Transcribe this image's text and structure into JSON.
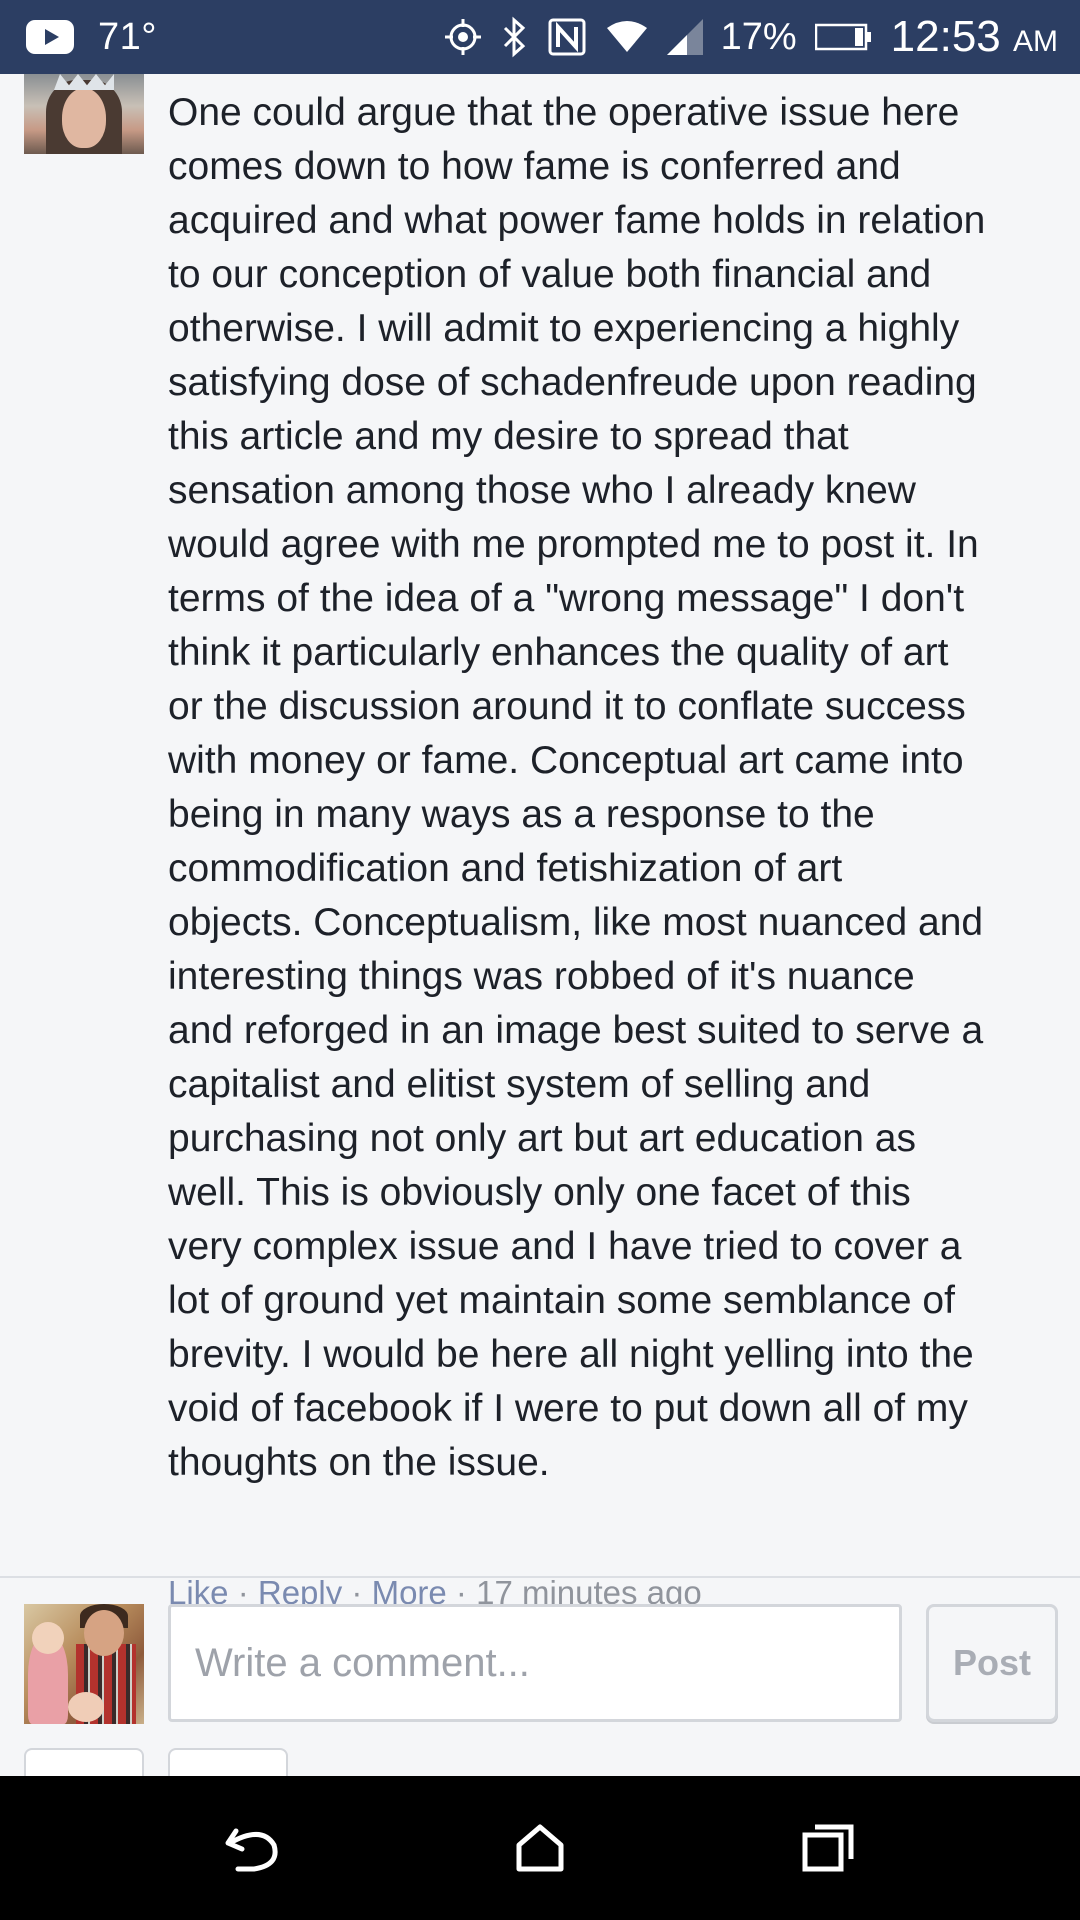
{
  "status_bar": {
    "temperature": "71°",
    "battery_percent": "17%",
    "time": "12:53",
    "ampm": "AM",
    "icons": [
      "youtube-icon",
      "location-icon",
      "bluetooth-icon",
      "nfc-icon",
      "wifi-icon",
      "signal-icon",
      "battery-icon"
    ]
  },
  "comment": {
    "lines": [
      "One could argue that the operative issue here",
      "comes down to how fame is conferred and",
      "acquired and what power fame holds in relation",
      "to our conception of value both financial and",
      "otherwise. I will admit to experiencing a highly",
      "satisfying dose of schadenfreude upon reading",
      "this article and my desire to spread that",
      "sensation among those who I already knew",
      "would agree with me prompted me to post it. In",
      "terms of the idea of a \"wrong message\" I don't",
      "think it particularly enhances the quality of art",
      "or the discussion around it to conflate success",
      "with money or fame. Conceptual art came into",
      "being in many ways as a response to the",
      "commodification and fetishization of art",
      "objects. Conceptualism, like most nuanced and",
      "interesting things was robbed of it's nuance",
      "and reforged in an image best suited to serve a",
      "capitalist and elitist system of selling and",
      "purchasing not only art but art education as",
      "well. This is obviously only one facet of this",
      "very complex issue and I have tried to cover a",
      "lot of ground yet maintain some semblance of",
      "brevity. I would be here all night yelling into the",
      "void of facebook if I were to put down all of my",
      "thoughts on the issue."
    ],
    "actions": {
      "like": "Like",
      "reply": "Reply",
      "more": "More",
      "separator": " · ",
      "timestamp": "17 minutes ago"
    }
  },
  "composer": {
    "placeholder": "Write a comment...",
    "post_label": "Post"
  },
  "colors": {
    "status_bar": "#2c3e63",
    "background": "#f5f6f8",
    "link": "#7a8ab0",
    "meta": "#90949c",
    "navbar": "#000000"
  }
}
